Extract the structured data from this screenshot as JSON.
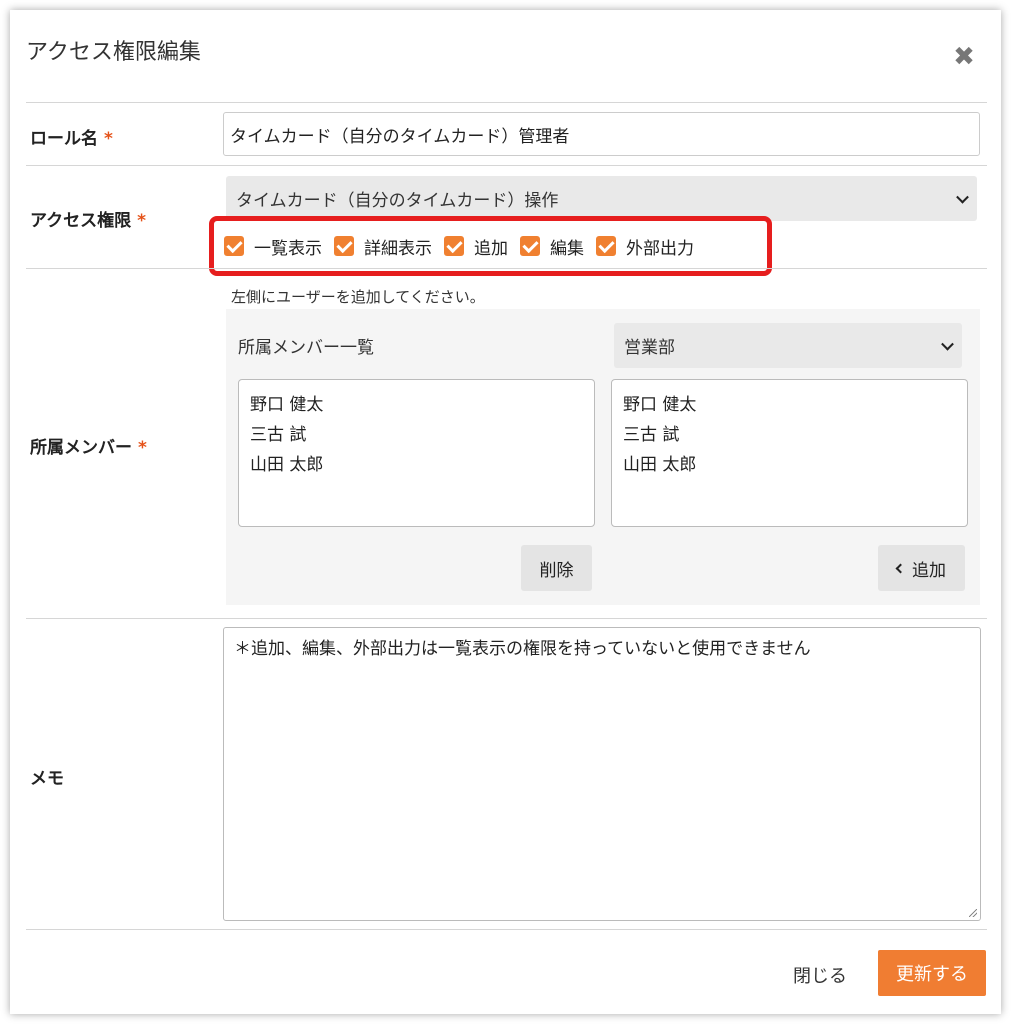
{
  "dialog": {
    "title": "アクセス権限編集",
    "close_icon": "close-icon"
  },
  "role": {
    "label": "ロール名",
    "required_mark": "*",
    "value": "タイムカード（自分のタイムカード）管理者"
  },
  "access": {
    "label": "アクセス権限",
    "required_mark": "*",
    "selected": "タイムカード（自分のタイムカード）操作",
    "permissions": [
      {
        "label": "一覧表示",
        "checked": true
      },
      {
        "label": "詳細表示",
        "checked": true
      },
      {
        "label": "追加",
        "checked": true
      },
      {
        "label": "編集",
        "checked": true
      },
      {
        "label": "外部出力",
        "checked": true
      }
    ]
  },
  "members": {
    "label": "所属メンバー",
    "required_mark": "*",
    "hint": "左側にユーザーを追加してください。",
    "panel_title": "所属メンバー一覧",
    "department": "営業部",
    "left_list": [
      "野口 健太",
      "三古 試",
      "山田 太郎"
    ],
    "right_list": [
      "野口 健太",
      "三古 試",
      "山田 太郎"
    ],
    "delete_label": "削除",
    "add_label": "追加"
  },
  "memo": {
    "label": "メモ",
    "value": "＊追加、編集、外部出力は一覧表示の権限を持っていないと使用できません"
  },
  "footer": {
    "close_label": "閉じる",
    "update_label": "更新する"
  },
  "colors": {
    "accent": "#f07d32",
    "required": "#e5531a",
    "highlight_border": "#e61e1e"
  }
}
